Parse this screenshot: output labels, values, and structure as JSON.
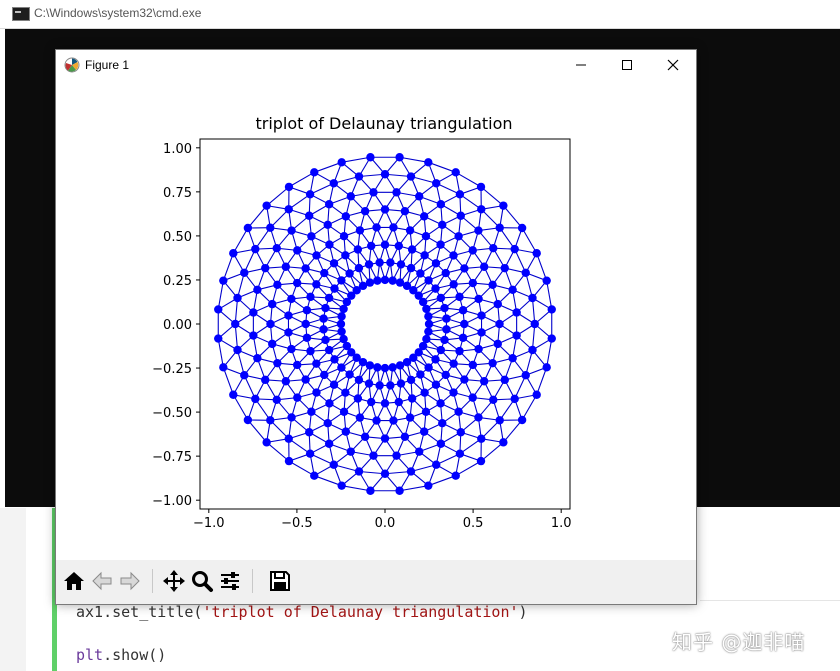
{
  "console": {
    "title": "C:\\Windows\\system32\\cmd.exe"
  },
  "figure": {
    "window_title": "Figure 1",
    "toolbar": [
      "home-icon",
      "back-icon",
      "forward-icon",
      "pan-icon",
      "zoom-icon",
      "configure-subplots-icon",
      "save-icon"
    ]
  },
  "editor": {
    "line1_obj": "ax1.set_title(",
    "line1_str": "'triplot of Delaunay triangulation'",
    "line1_end": ")",
    "line2_kw": "plt",
    "line2_rest": ".show()"
  },
  "watermark": "知乎 @迦非喵",
  "colors": {
    "marker": "#0000ff",
    "edge": "#0000cc",
    "console_bg": "#0c0c0c",
    "accent_bar": "#5fd068"
  },
  "chart_data": {
    "type": "scatter",
    "title": "triplot of Delaunay triangulation",
    "xlabel": "",
    "ylabel": "",
    "xlim": [
      -1.05,
      1.05
    ],
    "ylim": [
      -1.05,
      1.05
    ],
    "xticks": [
      -1.0,
      -0.5,
      0.0,
      0.5,
      1.0
    ],
    "xtick_labels": [
      "−1.0",
      "−0.5",
      "0.0",
      "0.5",
      "1.0"
    ],
    "yticks": [
      -1.0,
      -0.75,
      -0.5,
      -0.25,
      0.0,
      0.25,
      0.5,
      0.75,
      1.0
    ],
    "ytick_labels": [
      "−1.00",
      "−0.75",
      "−0.50",
      "−0.25",
      "0.00",
      "0.25",
      "0.50",
      "0.75",
      "1.00"
    ],
    "grid": false,
    "mesh": {
      "n_radii": 8,
      "n_angles": 36,
      "min_radius": 0.25,
      "max_radius": 0.95,
      "note": "annulus points r_i=linspace(min_radius,max_radius), angles offset by pi/n_angles on alternate rings; connected by Delaunay triangulation"
    }
  }
}
